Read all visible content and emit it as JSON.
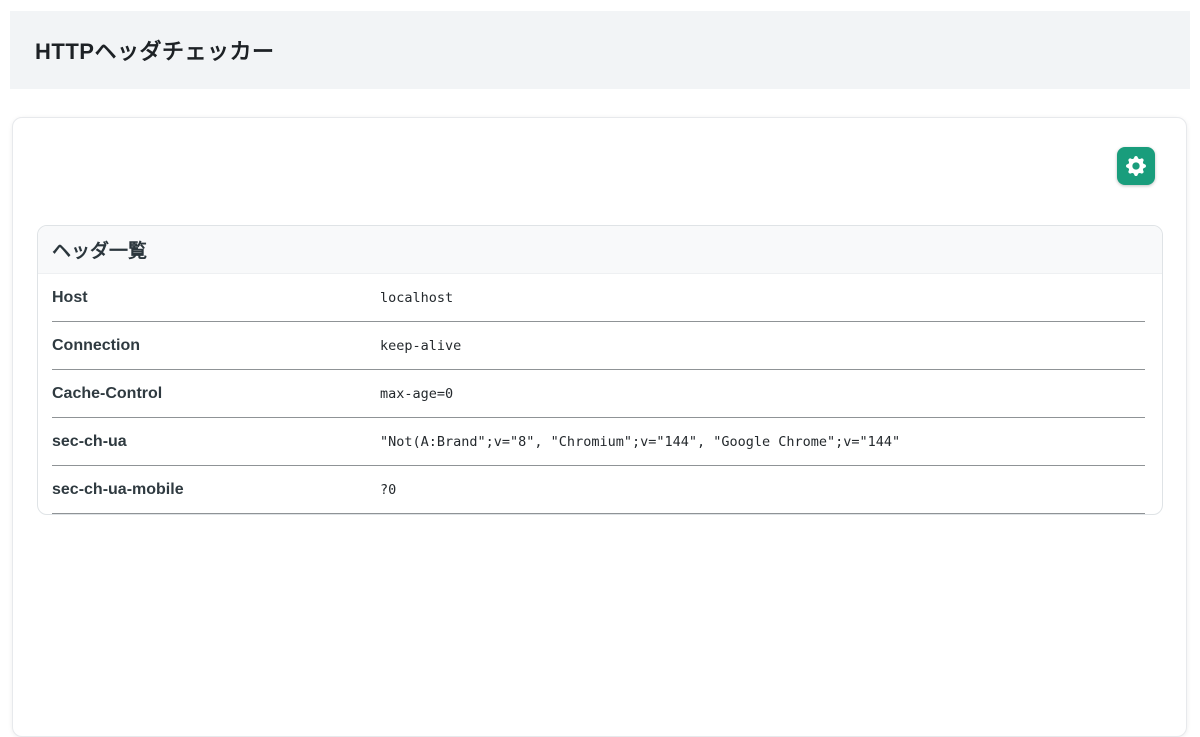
{
  "header": {
    "title": "HTTPヘッダチェッカー"
  },
  "toolbar": {
    "settings_icon": "gear-icon"
  },
  "headers_card": {
    "title": "ヘッダ一覧",
    "rows": [
      {
        "name": "Host",
        "value": "localhost"
      },
      {
        "name": "Connection",
        "value": "keep-alive"
      },
      {
        "name": "Cache-Control",
        "value": "max-age=0"
      },
      {
        "name": "sec-ch-ua",
        "value": "\"Not(A:Brand\";v=\"8\", \"Chromium\";v=\"144\", \"Google Chrome\";v=\"144\""
      },
      {
        "name": "sec-ch-ua-mobile",
        "value": "?0"
      }
    ]
  },
  "colors": {
    "accent": "#199d7c",
    "topbar_bg": "#f2f4f6",
    "card_header_bg": "#f8f9fa",
    "divider": "#8f9396"
  }
}
